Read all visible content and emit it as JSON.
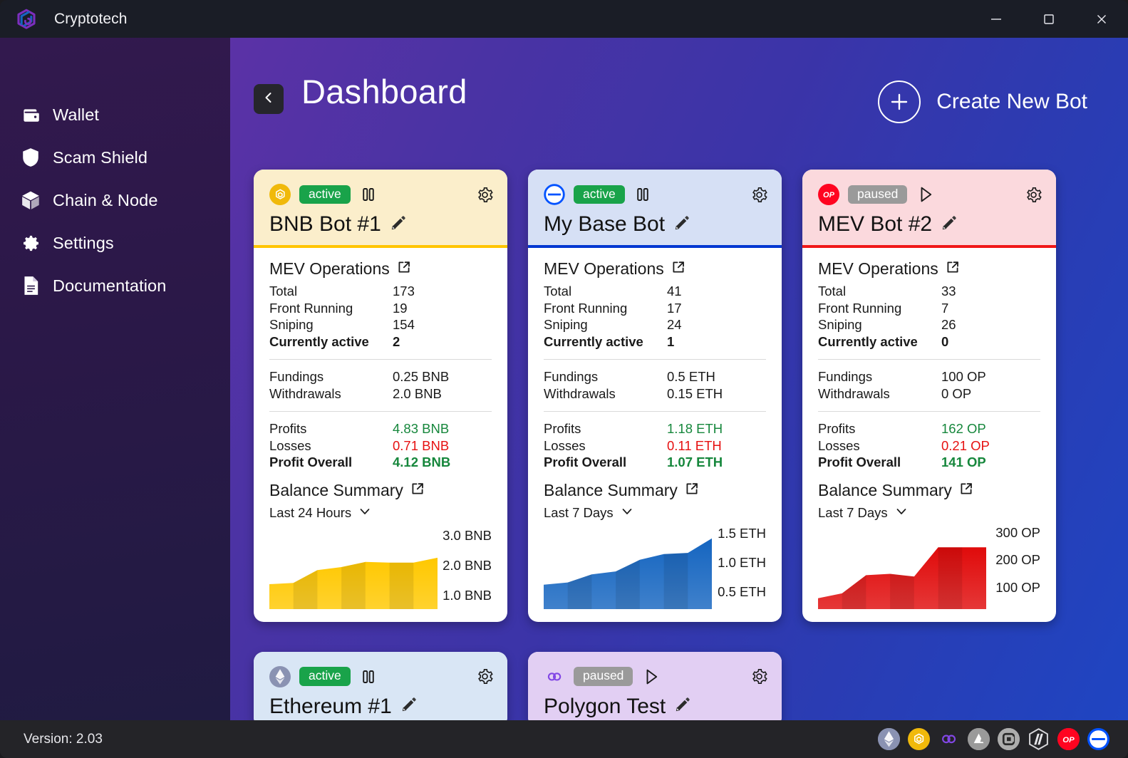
{
  "window": {
    "app_title": "Cryptotech",
    "logo_icon": "cryptotech-hex-logo",
    "controls": [
      {
        "name": "minimize",
        "icon": "minimize-icon"
      },
      {
        "name": "maximize",
        "icon": "maximize-icon"
      },
      {
        "name": "close",
        "icon": "close-icon"
      }
    ]
  },
  "sidebar": {
    "items": [
      {
        "label": "Wallet",
        "icon": "wallet-icon"
      },
      {
        "label": "Scam Shield",
        "icon": "shield-icon"
      },
      {
        "label": "Chain & Node",
        "icon": "cube-icon"
      },
      {
        "label": "Settings",
        "icon": "gear-icon"
      },
      {
        "label": "Documentation",
        "icon": "document-icon"
      }
    ]
  },
  "header": {
    "back_icon": "chevron-left-icon",
    "title": "Dashboard",
    "create_bot_label": "Create New Bot",
    "create_bot_icon": "plus-circle-icon"
  },
  "labels": {
    "mev_operations": "MEV Operations",
    "balance_summary": "Balance Summary",
    "total": "Total",
    "front_running": "Front Running",
    "sniping": "Sniping",
    "currently_active": "Currently active",
    "fundings": "Fundings",
    "withdrawals": "Withdrawals",
    "profits": "Profits",
    "losses": "Losses",
    "profit_overall": "Profit Overall",
    "external_link_icon": "external-link-icon",
    "edit_icon": "pencil-icon",
    "gear_icon": "gear-icon",
    "pause_icon": "pause-icon",
    "play_icon": "play-icon",
    "chevron_down_icon": "chevron-down-icon"
  },
  "colors": {
    "accent_green": "#19a34a",
    "accent_grey": "#9a9a9a",
    "profit_green": "#16873c",
    "loss_red": "#e61111",
    "bnb_gold": "#f0b90b",
    "base_blue": "#0052ff",
    "op_red": "#ff0420",
    "eth_violet": "#8a92b2",
    "polygon_purple": "#8247e5"
  },
  "cards": [
    {
      "id": "bnb-bot-1",
      "name": "BNB Bot #1",
      "status": "active",
      "control": "pause",
      "chain_icon": "bnb-icon",
      "header_bg": "#fbeecb",
      "accent": "#ffc400",
      "mev": {
        "total": "173",
        "front_running": "19",
        "sniping": "154",
        "currently_active": "2"
      },
      "funds": {
        "fundings": "0.25 BNB",
        "withdrawals": "2.0 BNB"
      },
      "pnl": {
        "profits": "4.83 BNB",
        "losses": "0.71 BNB",
        "overall": "4.12 BNB"
      },
      "chart_data": {
        "type": "area",
        "title": "Balance Summary",
        "range_label": "Last 24 Hours",
        "unit": "BNB",
        "ytick_labels": [
          "3.0 BNB",
          "2.0 BNB",
          "1.0 BNB"
        ],
        "yticks": [
          3.0,
          2.0,
          1.0
        ],
        "ylim": [
          0.55,
          3.35
        ],
        "x": [
          0,
          1,
          2,
          3,
          4,
          5,
          6,
          7
        ],
        "values": [
          1.38,
          1.42,
          1.85,
          1.95,
          2.12,
          2.1,
          2.1,
          2.26
        ],
        "series_color": "#ffc800",
        "grid": false,
        "legend": "none"
      }
    },
    {
      "id": "my-base-bot",
      "name": "My Base Bot",
      "status": "active",
      "control": "pause",
      "chain_icon": "base-icon",
      "header_bg": "#d6e0f5",
      "accent": "#0037d1",
      "mev": {
        "total": "41",
        "front_running": "17",
        "sniping": "24",
        "currently_active": "1"
      },
      "funds": {
        "fundings": "0.5 ETH",
        "withdrawals": "0.15 ETH"
      },
      "pnl": {
        "profits": "1.18 ETH",
        "losses": "0.11 ETH",
        "overall": "1.07 ETH"
      },
      "chart_data": {
        "type": "area",
        "title": "Balance Summary",
        "range_label": "Last 7 Days",
        "unit": "ETH",
        "ytick_labels": [
          "1.5 ETH",
          "1.0 ETH",
          "0.5 ETH"
        ],
        "yticks": [
          1.5,
          1.0,
          0.5
        ],
        "ylim": [
          0.2,
          1.65
        ],
        "x": [
          0,
          1,
          2,
          3,
          4,
          5,
          6,
          7
        ],
        "values": [
          0.62,
          0.66,
          0.8,
          0.85,
          1.05,
          1.15,
          1.17,
          1.42
        ],
        "series_color": "#1565c0",
        "grid": false,
        "legend": "none"
      }
    },
    {
      "id": "mev-bot-2",
      "name": "MEV Bot #2",
      "status": "paused",
      "control": "play",
      "chain_icon": "optimism-icon",
      "header_bg": "#fbd9dd",
      "accent": "#f01818",
      "mev": {
        "total": "33",
        "front_running": "7",
        "sniping": "26",
        "currently_active": "0"
      },
      "funds": {
        "fundings": "100 OP",
        "withdrawals": "0 OP"
      },
      "pnl": {
        "profits": "162 OP",
        "losses": "0.21 OP",
        "overall": "141 OP"
      },
      "chart_data": {
        "type": "area",
        "title": "Balance Summary",
        "range_label": "Last 7 Days",
        "unit": "OP",
        "ytick_labels": [
          "300 OP",
          "200 OP",
          "100 OP"
        ],
        "yticks": [
          300,
          200,
          100
        ],
        "ylim": [
          20,
          330
        ],
        "x": [
          0,
          1,
          2,
          3,
          4,
          5,
          6,
          7
        ],
        "values": [
          60,
          78,
          145,
          150,
          140,
          248,
          248,
          248
        ],
        "series_color": "#e00b0b",
        "grid": false,
        "legend": "none"
      }
    }
  ],
  "cards_partial": [
    {
      "id": "ethereum-1",
      "name": "Ethereum #1",
      "status": "active",
      "control": "pause",
      "chain_icon": "ethereum-icon",
      "header_bg": "#d9e6f5",
      "accent": "#4d6bc6"
    },
    {
      "id": "polygon-test",
      "name": "Polygon Test",
      "status": "paused",
      "control": "play",
      "chain_icon": "polygon-icon",
      "header_bg": "#e2cff3",
      "accent": "#8247e5"
    }
  ],
  "statusbar": {
    "version": "Version: 2.03",
    "chains": [
      {
        "name": "ethereum-icon",
        "bg": "#8a92b2"
      },
      {
        "name": "bnb-icon",
        "bg": "#f0b90b"
      },
      {
        "name": "polygon-icon",
        "bg": "transparent"
      },
      {
        "name": "avalanche-icon",
        "bg": "#9a9a9a"
      },
      {
        "name": "celo-icon",
        "bg": "#9a9a9a"
      },
      {
        "name": "arbitrum-icon",
        "bg": "transparent"
      },
      {
        "name": "optimism-icon",
        "bg": "#ff0420"
      },
      {
        "name": "base-icon",
        "bg": "#0052ff"
      }
    ]
  }
}
